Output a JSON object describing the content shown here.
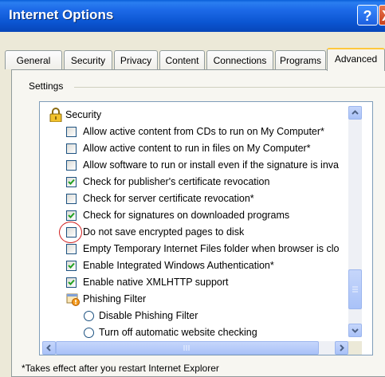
{
  "window": {
    "title": "Internet Options",
    "help_label": "?",
    "close_label": "X"
  },
  "tabs": [
    {
      "label": "General",
      "active": false
    },
    {
      "label": "Security",
      "active": false
    },
    {
      "label": "Privacy",
      "active": false
    },
    {
      "label": "Content",
      "active": false
    },
    {
      "label": "Connections",
      "active": false
    },
    {
      "label": "Programs",
      "active": false
    },
    {
      "label": "Advanced",
      "active": true
    }
  ],
  "settings": {
    "group_label": "Settings",
    "items": [
      {
        "kind": "category",
        "icon": "lock-icon",
        "label": "Security"
      },
      {
        "kind": "checkbox",
        "checked": false,
        "label": "Allow active content from CDs to run on My Computer*"
      },
      {
        "kind": "checkbox",
        "checked": false,
        "label": "Allow active content to run in files on My Computer*"
      },
      {
        "kind": "checkbox",
        "checked": false,
        "label": "Allow software to run or install even if the signature is inva"
      },
      {
        "kind": "checkbox",
        "checked": true,
        "label": "Check for publisher's certificate revocation"
      },
      {
        "kind": "checkbox",
        "checked": false,
        "label": "Check for server certificate revocation*"
      },
      {
        "kind": "checkbox",
        "checked": true,
        "label": "Check for signatures on downloaded programs"
      },
      {
        "kind": "checkbox",
        "checked": false,
        "label": "Do not save encrypted pages to disk",
        "highlighted": true
      },
      {
        "kind": "checkbox",
        "checked": false,
        "label": "Empty Temporary Internet Files folder when browser is clo"
      },
      {
        "kind": "checkbox",
        "checked": true,
        "label": "Enable Integrated Windows Authentication*"
      },
      {
        "kind": "checkbox",
        "checked": true,
        "label": "Enable native XMLHTTP support"
      },
      {
        "kind": "category",
        "icon": "phishing-shield-icon",
        "label": "Phishing Filter"
      },
      {
        "kind": "radio",
        "checked": false,
        "label": "Disable Phishing Filter"
      },
      {
        "kind": "radio",
        "checked": false,
        "label": "Turn off automatic website checking"
      }
    ]
  },
  "footnote": "*Takes effect after you restart Internet Explorer",
  "colors": {
    "titlebar": "#0b55d1",
    "highlight_circle": "#d02020",
    "checkmark": "#21a121",
    "tab_accent": "#ffc83c"
  }
}
